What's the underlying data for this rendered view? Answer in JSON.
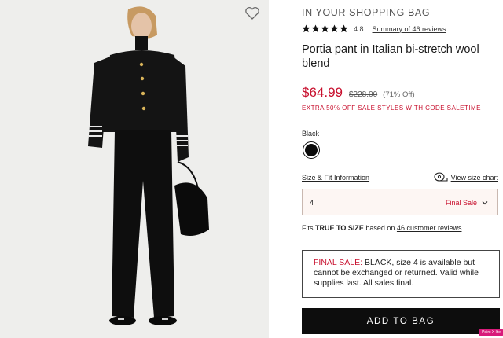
{
  "product_image": {
    "wishlist_icon": "heart-outline-icon",
    "background": "#eeeeec"
  },
  "header": {
    "prefix": "IN YOUR",
    "bag_link": "SHOPPING BAG"
  },
  "rating": {
    "stars": 5,
    "value": "4.8",
    "reviews_link": "Summary of 46 reviews"
  },
  "product": {
    "title": "Portia pant in Italian bi-stretch wool blend",
    "price": "$64.99",
    "original_price": "$228.00",
    "discount": "(71% Off)",
    "promo": "EXTRA 50% OFF SALE STYLES WITH CODE SALETIME"
  },
  "color": {
    "label": "Black",
    "swatch_hex": "#0a0a0a"
  },
  "size": {
    "fit_link": "Size & Fit Information",
    "chart_link": "View size chart",
    "selected": "4",
    "status": "Final Sale"
  },
  "fit": {
    "prefix": "Fits",
    "emphasis": "TRUE TO SIZE",
    "middle": "based on",
    "link": "46 customer reviews"
  },
  "notice": {
    "label": "FINAL SALE:",
    "text": "BLACK, size 4 is available but cannot be exchanged or returned. Valid while supplies last. All sales final."
  },
  "cta": {
    "label": "ADD TO BAG"
  },
  "badge": {
    "label": "Paint X lite"
  },
  "colors": {
    "accent_red": "#c8102e",
    "button_black": "#0d0d0d",
    "select_bg": "#fdf6f3"
  }
}
